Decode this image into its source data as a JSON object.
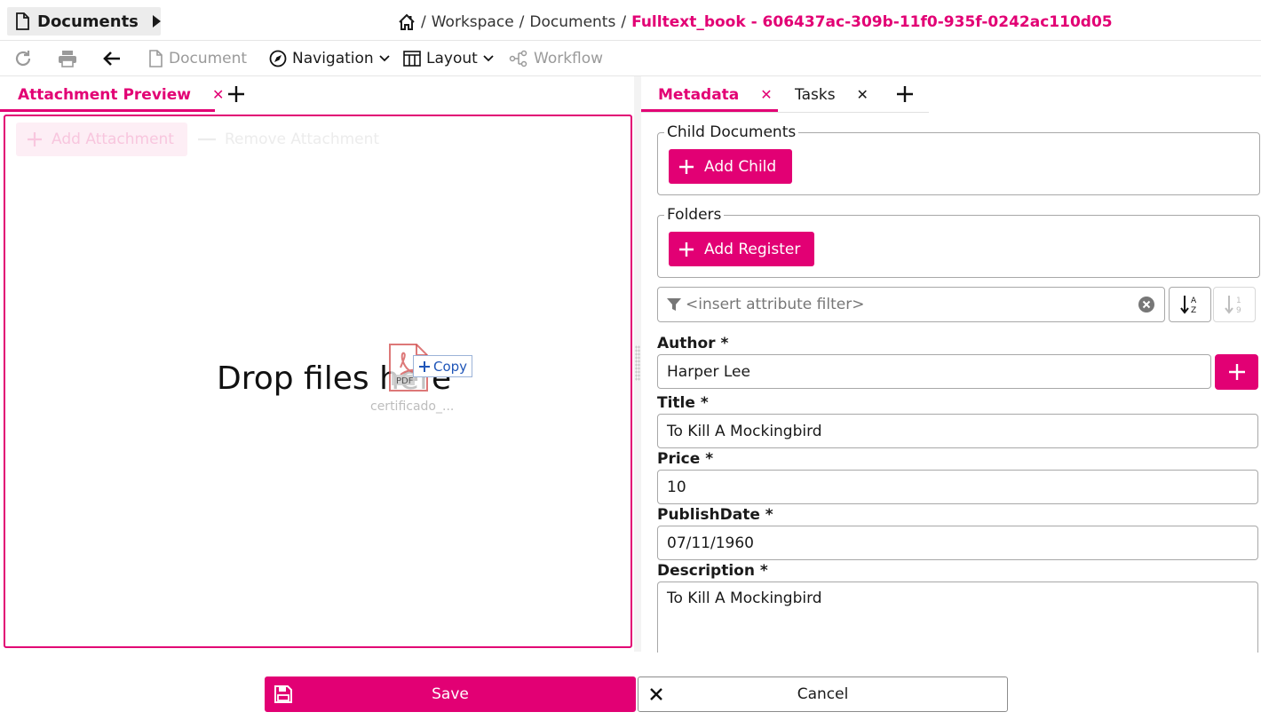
{
  "header": {
    "menu_label": "Documents",
    "breadcrumb": [
      "Workspace",
      "Documents"
    ],
    "current": "Fulltext_book - 606437ac-309b-11f0-935f-0242ac110d05",
    "separator": "/"
  },
  "toolbar": {
    "document_label": "Document",
    "navigation_label": "Navigation",
    "layout_label": "Layout",
    "workflow_label": "Workflow"
  },
  "left_panel": {
    "tab_label": "Attachment Preview",
    "add_attachment_label": "Add Attachment",
    "remove_attachment_label": "Remove Attachment",
    "drop_text": "Drop files here",
    "drag": {
      "copy_label": "Copy",
      "filename": "certificado_...",
      "file_type": "PDF"
    }
  },
  "right_panel": {
    "tabs": [
      {
        "label": "Metadata",
        "active": true
      },
      {
        "label": "Tasks",
        "active": false
      }
    ],
    "child_documents": {
      "legend": "Child Documents",
      "button": "Add Child"
    },
    "folders": {
      "legend": "Folders",
      "button": "Add Register"
    },
    "filter": {
      "placeholder": "<insert attribute filter>"
    },
    "fields": {
      "author": {
        "label": "Author *",
        "value": "Harper Lee"
      },
      "title": {
        "label": "Title *",
        "value": "To Kill A Mockingbird"
      },
      "price": {
        "label": "Price *",
        "value": "10"
      },
      "publish_date": {
        "label": "PublishDate *",
        "value": "07/11/1960"
      },
      "description": {
        "label": "Description *",
        "value": "To Kill A Mockingbird"
      }
    }
  },
  "footer": {
    "save_label": "Save",
    "cancel_label": "Cancel"
  },
  "colors": {
    "accent": "#e20074",
    "border": "#a8a8a8",
    "disabled_text": "#9a9a9a"
  },
  "icons": [
    "document-icon",
    "caret-right-icon",
    "home-icon",
    "refresh-icon",
    "print-icon",
    "back-arrow-icon",
    "compass-icon",
    "chevron-down-icon",
    "layout-icon",
    "workflow-icon",
    "close-icon",
    "plus-icon",
    "pdf-icon",
    "filter-icon",
    "clear-icon",
    "sort-alpha-icon",
    "sort-numeric-icon",
    "save-icon"
  ]
}
